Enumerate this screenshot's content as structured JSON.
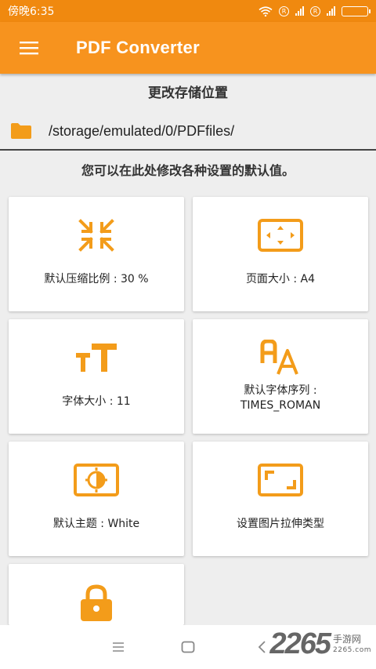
{
  "status_bar": {
    "time": "傍晚6:35",
    "network_label": "R"
  },
  "app_bar": {
    "title": "PDF Converter",
    "menu_icon": "hamburger-menu-icon"
  },
  "storage": {
    "heading": "更改存储位置",
    "path": "/storage/emulated/0/PDFfiles/"
  },
  "hint": "您可以在此处修改各种设置的默认值。",
  "settings": [
    {
      "label": "默认压缩比例 : 30 %",
      "icon": "compress-icon"
    },
    {
      "label": "页面大小 : A4",
      "icon": "page-size-icon"
    },
    {
      "label": "字体大小 : 11",
      "icon": "font-size-icon"
    },
    {
      "label": "默认字体序列 :",
      "label2": "TIMES_ROMAN",
      "icon": "font-family-icon"
    },
    {
      "label": "默认主题 : White",
      "icon": "theme-icon"
    },
    {
      "label": "设置图片拉伸类型",
      "icon": "image-scale-icon"
    },
    {
      "label": "",
      "icon": "lock-icon"
    }
  ],
  "watermark": {
    "number": "2265",
    "text_cn": "手游网",
    "text_en": "2265.com"
  },
  "colors": {
    "accent": "#f7931e",
    "status_bar": "#f0890f",
    "icon": "#f39c1a"
  }
}
